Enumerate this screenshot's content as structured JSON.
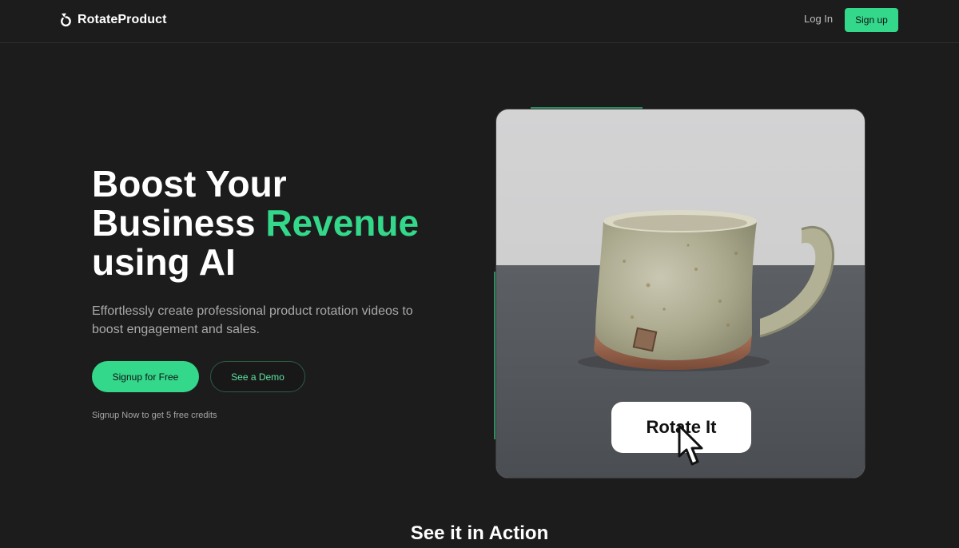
{
  "nav": {
    "brand": "RotateProduct",
    "brand_icon": "rotate-arrow-icon",
    "login": "Log In",
    "signup": "Sign up"
  },
  "hero": {
    "title_line1": "Boost Your",
    "title_line2_start": "Business ",
    "title_line2_accent": "Revenue",
    "title_line3": "using AI",
    "subtitle": "Effortlessly create professional product rotation videos to boost engagement and sales.",
    "cta_primary": "Signup for Free",
    "cta_secondary": "See a Demo",
    "note": "Signup Now to get 5 free credits"
  },
  "media": {
    "rotate_button": "Rotate It",
    "cursor_icon": "pointer-cursor-icon"
  },
  "section": {
    "title": "See it in Action"
  },
  "colors": {
    "accent": "#34d88b",
    "background": "#1c1c1c",
    "text_muted": "#a9a9a9"
  }
}
